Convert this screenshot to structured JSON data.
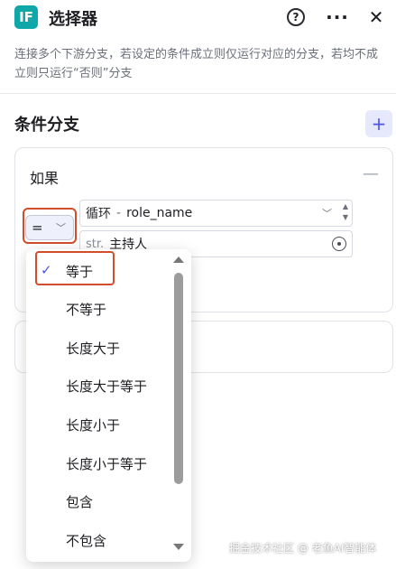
{
  "header": {
    "logo_text": "IF",
    "title": "选择器",
    "help_icon": "help-circle-icon",
    "more_icon": "more-horizontal-icon",
    "close_icon": "close-icon"
  },
  "description": "连接多个下游分支，若设定的条件成立则仅运行对应的分支，若均不成立则只运行“否则”分支",
  "branch": {
    "title": "条件分支",
    "add_icon": "plus-icon"
  },
  "condition_card": {
    "title": "如果",
    "collapse_icon": "minus-icon",
    "operator": "=",
    "variable_prefix": "循环",
    "variable_sep": "-",
    "variable_name": "role_name",
    "value_type": "str.",
    "value": "主持人"
  },
  "dropdown": {
    "options": [
      {
        "label": "等于",
        "selected": true
      },
      {
        "label": "不等于",
        "selected": false
      },
      {
        "label": "长度大于",
        "selected": false
      },
      {
        "label": "长度大于等于",
        "selected": false
      },
      {
        "label": "长度小于",
        "selected": false
      },
      {
        "label": "长度小于等于",
        "selected": false
      },
      {
        "label": "包含",
        "selected": false
      },
      {
        "label": "不包含",
        "selected": false
      }
    ]
  },
  "watermark": "掘金技术社区 @ 老鱼AI智能体",
  "colors": {
    "accent": "#4c56e4",
    "logo_bg": "#10a7a9",
    "highlight_box": "#d24d2a"
  }
}
